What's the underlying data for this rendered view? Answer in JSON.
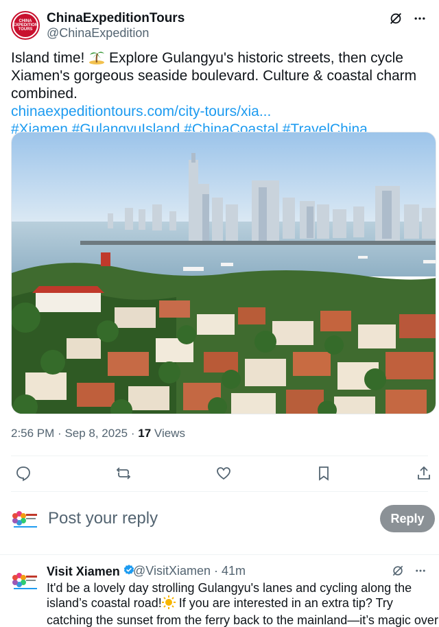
{
  "post": {
    "author_name": "ChinaExpeditionTours",
    "author_handle": "@ChinaExpedition",
    "avatar_text": "CHINA EXPEDITION TOURS",
    "text_line1": "Island time! ",
    "text_line1b": " Explore Gulangyu's historic streets, then cycle Xiamen's gorgeous seaside boulevard. Culture & coastal charm combined.",
    "link": "chinaexpeditiontours.com/city-tours/xia...",
    "hashtags": "#Xiamen #GulangyuIsland #ChinaCoastal #TravelChina",
    "time": "2:56 PM",
    "date": "Sep 8, 2025",
    "views_count": "17",
    "views_label": "Views"
  },
  "reply_composer": {
    "placeholder": "Post your reply",
    "button_label": "Reply"
  },
  "reply": {
    "author_name": "Visit Xiamen",
    "author_handle": "@VisitXiamen",
    "time_ago": "41m",
    "text_part1": "It'd be a lovely day strolling Gulangyu's lanes and cycling along the island’s coastal road!",
    "text_part2": " If you are interested in an extra tip? Try catching the sunset from the ferry back to the mainland—it’s magic over the water! "
  },
  "colors": {
    "link": "#1d9bf0",
    "secondary_text": "#536471",
    "brand_red": "#c8102e",
    "reply_button": "#8b9196"
  },
  "icons": [
    "grok-icon",
    "more-icon",
    "reply-icon",
    "repost-icon",
    "like-icon",
    "bookmark-icon",
    "share-icon",
    "verified-badge-icon",
    "palm-tree-emoji",
    "sun-emoji",
    "sunset-emoji"
  ]
}
